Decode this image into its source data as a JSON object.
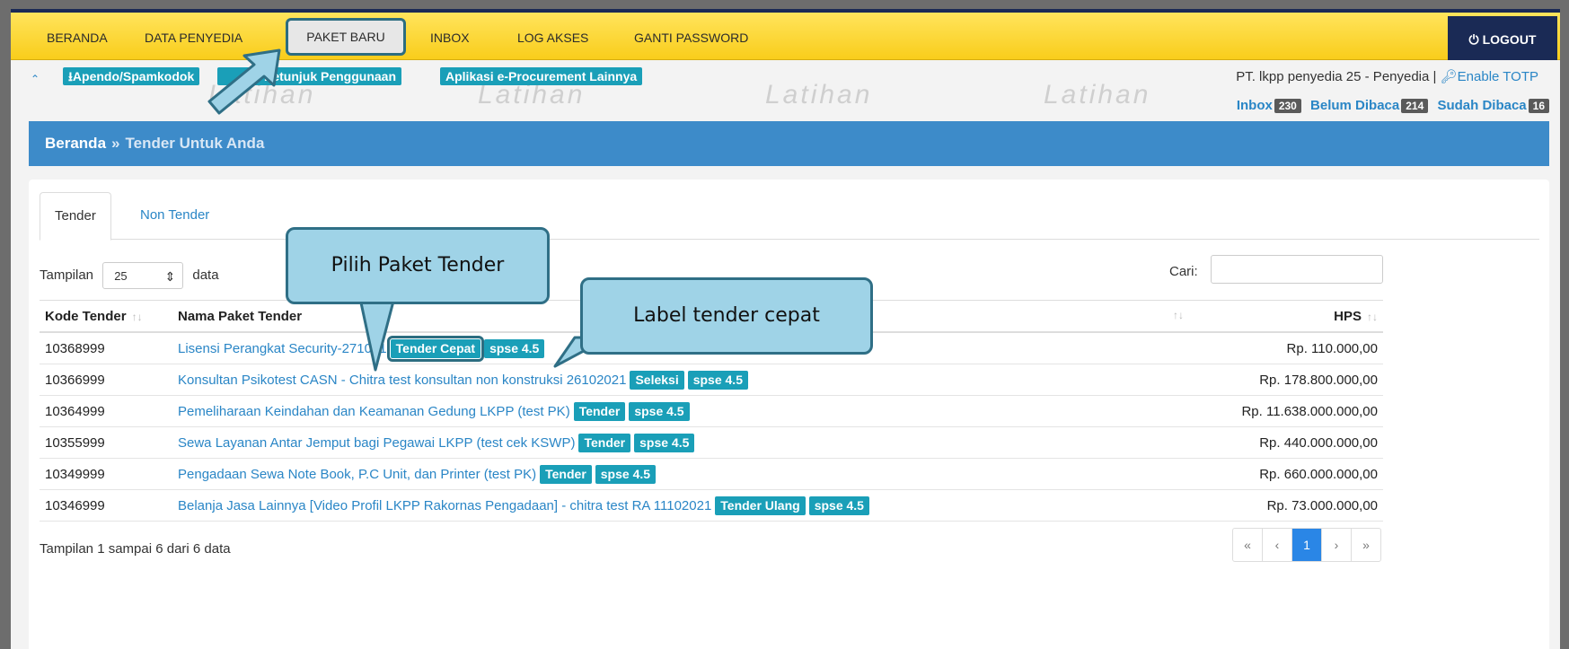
{
  "nav": {
    "items": [
      "BERANDA",
      "DATA PENYEDIA",
      "PAKET BARU",
      "INBOX",
      "LOG AKSES",
      "GANTI PASSWORD"
    ],
    "logout": "LOGOUT"
  },
  "subbar": {
    "links": [
      "Apendo/Spamkodok",
      "Petunjuk Penggunaan",
      "Aplikasi e-Procurement Lainnya"
    ],
    "account": "PT. lkpp penyedia 25 - Penyedia |",
    "enable_totp": "Enable TOTP",
    "inbox_label": "Inbox",
    "inbox_count": "230",
    "unread_label": "Belum Dibaca",
    "unread_count": "214",
    "read_label": "Sudah Dibaca",
    "read_count": "16",
    "watermark": "Latihan"
  },
  "breadcrumb": {
    "home": "Beranda",
    "separator": "»",
    "current": "Tender Untuk Anda"
  },
  "tabs": [
    "Tender",
    "Non Tender"
  ],
  "controls": {
    "show_label": "Tampilan",
    "page_size": "25",
    "data_label": "data",
    "search_label": "Cari:"
  },
  "table": {
    "headers": [
      "Kode Tender",
      "Nama Paket Tender",
      "HPS"
    ],
    "rows": [
      {
        "code": "10368999",
        "name": "Lisensi Perangkat Security-271021",
        "badges": [
          "Tender Cepat",
          "spse 4.5"
        ],
        "hps": "Rp. 110.000,00"
      },
      {
        "code": "10366999",
        "name": "Konsultan Psikotest CASN - Chitra test konsultan non konstruksi 26102021",
        "badges": [
          "Seleksi",
          "spse 4.5"
        ],
        "hps": "Rp. 178.800.000,00"
      },
      {
        "code": "10364999",
        "name": "Pemeliharaan Keindahan dan Keamanan Gedung LKPP (test PK)",
        "badges": [
          "Tender",
          "spse 4.5"
        ],
        "hps": "Rp. 11.638.000.000,00"
      },
      {
        "code": "10355999",
        "name": "Sewa Layanan Antar Jemput bagi Pegawai LKPP (test cek KSWP)",
        "badges": [
          "Tender",
          "spse 4.5"
        ],
        "hps": "Rp. 440.000.000,00"
      },
      {
        "code": "10349999",
        "name": "Pengadaan Sewa Note Book, P.C Unit, dan Printer (test PK)",
        "badges": [
          "Tender",
          "spse 4.5"
        ],
        "hps": "Rp. 660.000.000,00"
      },
      {
        "code": "10346999",
        "name": "Belanja Jasa Lainnya [Video Profil LKPP Rakornas Pengadaan] - chitra test RA 11102021",
        "badges": [
          "Tender Ulang",
          "spse 4.5"
        ],
        "hps": "Rp. 73.000.000,00"
      }
    ]
  },
  "footer": {
    "info": "Tampilan 1 sampai 6 dari 6 data",
    "pager": [
      "«",
      "‹",
      "1",
      "›",
      "»"
    ]
  },
  "callouts": {
    "pick": "Pilih Paket Tender",
    "label": "Label tender cepat"
  }
}
